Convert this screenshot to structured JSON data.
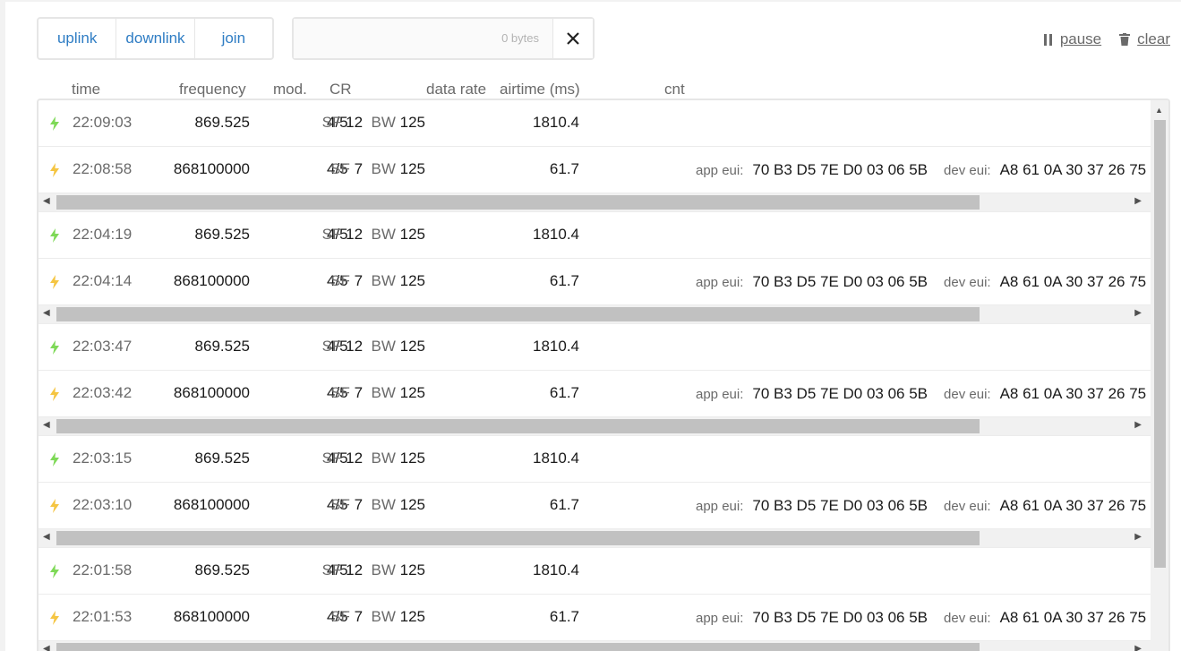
{
  "tabs": [
    "uplink",
    "downlink",
    "join"
  ],
  "filter": {
    "placeholder": "",
    "bytes": "0 bytes"
  },
  "actions": {
    "pause": "pause",
    "clear": "clear"
  },
  "headers": {
    "time": "time",
    "frequency": "frequency",
    "mod": "mod.",
    "cr": "CR",
    "data_rate": "data rate",
    "airtime": "airtime (ms)",
    "cnt": "cnt"
  },
  "labels": {
    "sf": "SF",
    "bw": "BW",
    "app_eui": "app eui:",
    "dev_eui": "dev eui:"
  },
  "colors": {
    "uplink_bolt": "#7ed957",
    "downlink_bolt": "#f5c542",
    "link": "#2f7dc4"
  },
  "groups": [
    {
      "downlink": {
        "time": "22:09:03",
        "frequency": "869.525",
        "cr": "4/5",
        "sf": "12",
        "bw": "125",
        "airtime": "1810.4"
      },
      "uplink": {
        "time": "22:08:58",
        "frequency": "868100000",
        "cr": "4/5",
        "sf": "7",
        "bw": "125",
        "airtime": "61.7",
        "app_eui": "70 B3 D5 7E D0 03 06 5B",
        "dev_eui": "A8 61 0A 30 37 26 75"
      }
    },
    {
      "downlink": {
        "time": "22:04:19",
        "frequency": "869.525",
        "cr": "4/5",
        "sf": "12",
        "bw": "125",
        "airtime": "1810.4"
      },
      "uplink": {
        "time": "22:04:14",
        "frequency": "868100000",
        "cr": "4/5",
        "sf": "7",
        "bw": "125",
        "airtime": "61.7",
        "app_eui": "70 B3 D5 7E D0 03 06 5B",
        "dev_eui": "A8 61 0A 30 37 26 75"
      }
    },
    {
      "downlink": {
        "time": "22:03:47",
        "frequency": "869.525",
        "cr": "4/5",
        "sf": "12",
        "bw": "125",
        "airtime": "1810.4"
      },
      "uplink": {
        "time": "22:03:42",
        "frequency": "868100000",
        "cr": "4/5",
        "sf": "7",
        "bw": "125",
        "airtime": "61.7",
        "app_eui": "70 B3 D5 7E D0 03 06 5B",
        "dev_eui": "A8 61 0A 30 37 26 75"
      }
    },
    {
      "downlink": {
        "time": "22:03:15",
        "frequency": "869.525",
        "cr": "4/5",
        "sf": "12",
        "bw": "125",
        "airtime": "1810.4"
      },
      "uplink": {
        "time": "22:03:10",
        "frequency": "868100000",
        "cr": "4/5",
        "sf": "7",
        "bw": "125",
        "airtime": "61.7",
        "app_eui": "70 B3 D5 7E D0 03 06 5B",
        "dev_eui": "A8 61 0A 30 37 26 75"
      }
    },
    {
      "downlink": {
        "time": "22:01:58",
        "frequency": "869.525",
        "cr": "4/5",
        "sf": "12",
        "bw": "125",
        "airtime": "1810.4"
      },
      "uplink": {
        "time": "22:01:53",
        "frequency": "868100000",
        "cr": "4/5",
        "sf": "7",
        "bw": "125",
        "airtime": "61.7",
        "app_eui": "70 B3 D5 7E D0 03 06 5B",
        "dev_eui": "A8 61 0A 30 37 26 75"
      }
    }
  ]
}
